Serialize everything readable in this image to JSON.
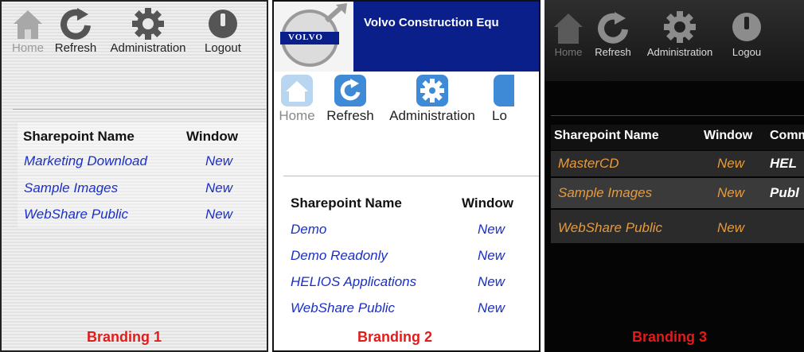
{
  "panel1": {
    "toolbar": [
      "Home",
      "Refresh",
      "Administration",
      "Logout"
    ],
    "headers": {
      "name": "Sharepoint Name",
      "window": "Window"
    },
    "rows": [
      {
        "name": "Marketing Download",
        "window": "New"
      },
      {
        "name": "Sample Images",
        "window": "New"
      },
      {
        "name": "WebShare Public",
        "window": "New"
      }
    ],
    "branding": "Branding 1"
  },
  "panel2": {
    "banner_title": "Volvo Construction Equ",
    "logo_text": "VOLVO",
    "toolbar": [
      "Home",
      "Refresh",
      "Administration",
      "Lo"
    ],
    "headers": {
      "name": "Sharepoint Name",
      "window": "Window"
    },
    "rows": [
      {
        "name": "Demo",
        "window": "New"
      },
      {
        "name": "Demo Readonly",
        "window": "New"
      },
      {
        "name": "HELIOS Applications",
        "window": "New"
      },
      {
        "name": "WebShare Public",
        "window": "New"
      }
    ],
    "branding": "Branding 2"
  },
  "panel3": {
    "toolbar": [
      "Home",
      "Refresh",
      "Administration",
      "Logou"
    ],
    "headers": {
      "name": "Sharepoint Name",
      "window": "Window",
      "comment": "Comm"
    },
    "rows": [
      {
        "name": "MasterCD",
        "window": "New",
        "comment": "HEL"
      },
      {
        "name": "Sample Images",
        "window": "New",
        "comment": "Publ"
      },
      {
        "name": "WebShare Public",
        "window": "New",
        "comment": ""
      }
    ],
    "branding": "Branding 3"
  },
  "colors": {
    "link_blue": "#1a2fc8",
    "branding_red": "#e21b1b",
    "volvo_navy": "#0a1f8a",
    "dark_orange": "#e79a3a"
  },
  "icons": [
    "home-icon",
    "refresh-icon",
    "gear-icon",
    "power-icon"
  ]
}
